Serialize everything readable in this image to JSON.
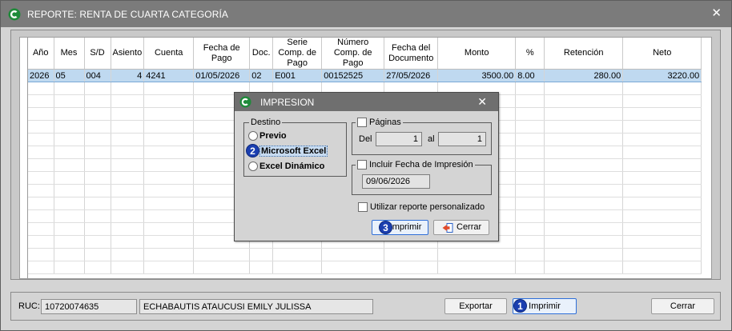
{
  "window": {
    "title": "REPORTE: RENTA DE CUARTA CATEGORÍA",
    "close_glyph": "✕"
  },
  "grid": {
    "columns": [
      {
        "label": "Año"
      },
      {
        "label": "Mes"
      },
      {
        "label": "S/D"
      },
      {
        "label": "Asiento"
      },
      {
        "label": "Cuenta"
      },
      {
        "label": "Fecha de Pago"
      },
      {
        "label": "Doc."
      },
      {
        "label": "Serie Comp. de Pago"
      },
      {
        "label": "Número Comp. de Pago"
      },
      {
        "label": "Fecha del Documento"
      },
      {
        "label": "Monto"
      },
      {
        "label": "%"
      },
      {
        "label": "Retención"
      },
      {
        "label": "Neto"
      }
    ],
    "rows": [
      [
        "2026",
        "05",
        "004",
        "4",
        "4241",
        "01/05/2026",
        "02",
        "E001",
        "00152525",
        "27/05/2026",
        "3500.00",
        "8.00",
        "280.00",
        "3220.00"
      ]
    ]
  },
  "bottom": {
    "ruc_label": "RUC:",
    "ruc_value": "10720074635",
    "name_value": "ECHABAUTIS ATAUCUSI EMILY JULISSA",
    "export_label": "Exportar",
    "print_label": "Imprimir",
    "close_label": "Cerrar"
  },
  "dialog": {
    "title": "IMPRESION",
    "close_glyph": "✕",
    "destino_legend": "Destino",
    "options": [
      "Previo",
      "Microsoft Excel",
      "Excel Dinámico"
    ],
    "paginas_label": "Páginas",
    "del_label": "Del",
    "del_value": "1",
    "al_label": "al",
    "al_value": "1",
    "fecha_label": "Incluir Fecha de Impresión",
    "fecha_value": "09/06/2026",
    "custom_label": "Utilizar reporte personalizado",
    "print_label": "Imprimir",
    "close_label": "Cerrar"
  },
  "badges": {
    "one": "1",
    "two": "2",
    "three": "3"
  },
  "colors": {
    "titlebar": "#7b7b7b",
    "selected_row": "#bfd9f0",
    "badge": "#1b3fb0"
  }
}
